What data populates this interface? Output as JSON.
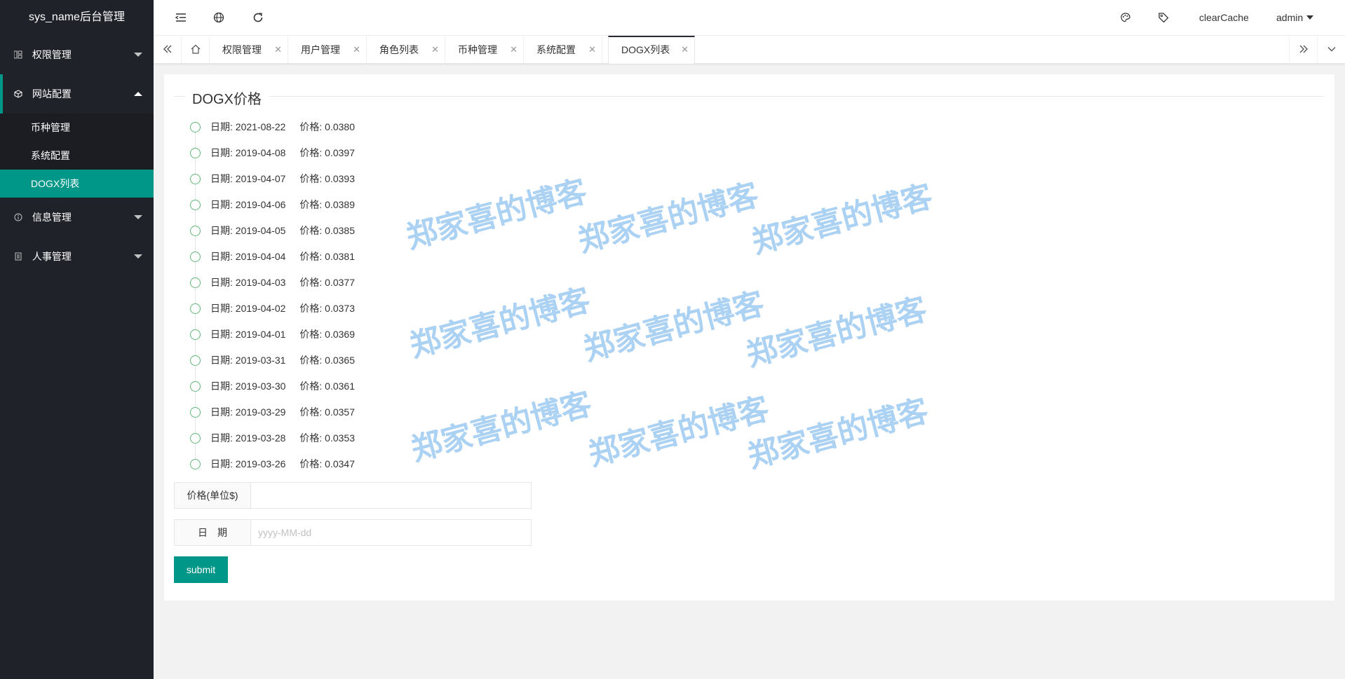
{
  "sidebar": {
    "logo": "sys_name后台管理",
    "groups": [
      {
        "label": "权限管理"
      },
      {
        "label": "网站配置",
        "children": [
          {
            "label": "币种管理"
          },
          {
            "label": "系统配置"
          },
          {
            "label": "DOGX列表"
          }
        ]
      },
      {
        "label": "信息管理"
      },
      {
        "label": "人事管理"
      }
    ]
  },
  "header": {
    "clear_cache": "clearCache",
    "user": "admin"
  },
  "tabs": [
    "权限管理",
    "用户管理",
    "角色列表",
    "币种管理",
    "系统配置",
    "DOGX列表"
  ],
  "main": {
    "title": "DOGX价格",
    "timeline": [
      {
        "date": "日期: 2021-08-22",
        "price": "价格: 0.0380"
      },
      {
        "date": "日期: 2019-04-08",
        "price": "价格: 0.0397"
      },
      {
        "date": "日期: 2019-04-07",
        "price": "价格: 0.0393"
      },
      {
        "date": "日期: 2019-04-06",
        "price": "价格: 0.0389"
      },
      {
        "date": "日期: 2019-04-05",
        "price": "价格: 0.0385"
      },
      {
        "date": "日期: 2019-04-04",
        "price": "价格: 0.0381"
      },
      {
        "date": "日期: 2019-04-03",
        "price": "价格: 0.0377"
      },
      {
        "date": "日期: 2019-04-02",
        "price": "价格: 0.0373"
      },
      {
        "date": "日期: 2019-04-01",
        "price": "价格: 0.0369"
      },
      {
        "date": "日期: 2019-03-31",
        "price": "价格: 0.0365"
      },
      {
        "date": "日期: 2019-03-30",
        "price": "价格: 0.0361"
      },
      {
        "date": "日期: 2019-03-29",
        "price": "价格: 0.0357"
      },
      {
        "date": "日期: 2019-03-28",
        "price": "价格: 0.0353"
      },
      {
        "date": "日期: 2019-03-26",
        "price": "价格: 0.0347"
      }
    ],
    "form": {
      "price_label": "价格(单位$)",
      "price_value": "",
      "date_label": "日　期",
      "date_placeholder": "yyyy-MM-dd",
      "submit": "submit"
    }
  },
  "watermark": "郑家喜的博客",
  "colors": {
    "accent": "#009688",
    "sidebar_bg": "#20222a",
    "timeline_dot": "#5fb878",
    "watermark": "#78b4eb"
  }
}
